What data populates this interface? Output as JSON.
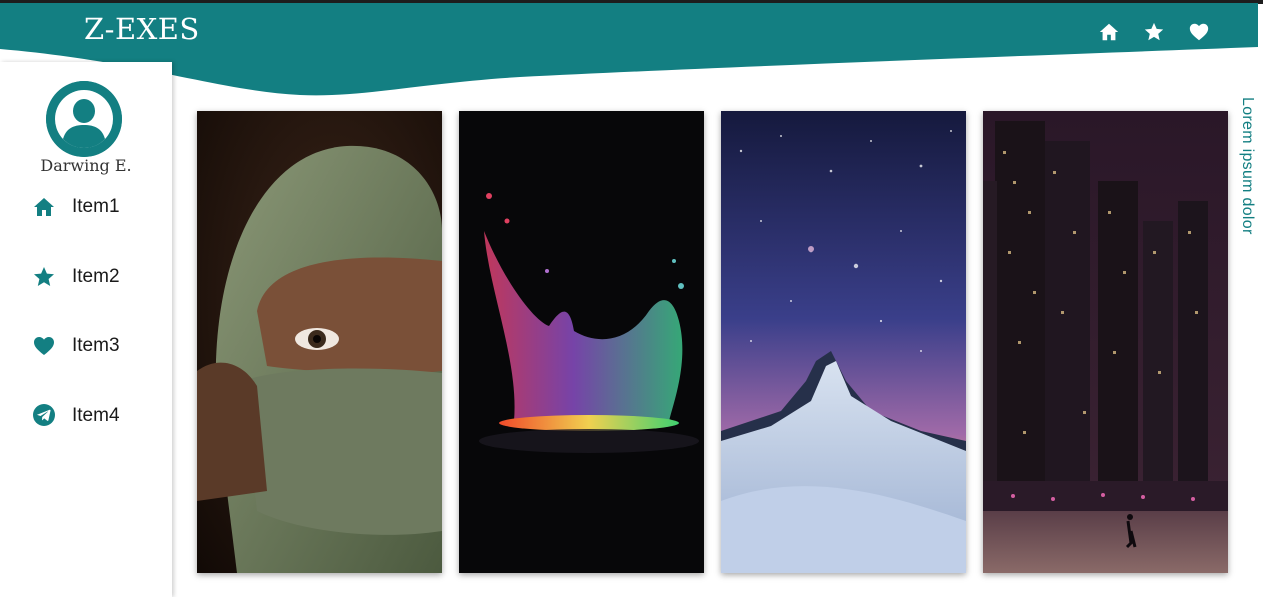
{
  "app": {
    "brand": "Z-EXES",
    "accent_color": "#137f82"
  },
  "header": {
    "actions": [
      {
        "icon": "home-icon"
      },
      {
        "icon": "star-icon"
      },
      {
        "icon": "heart-icon"
      }
    ]
  },
  "sidebar": {
    "user": {
      "name": "Darwing E.",
      "avatar_icon": "user-avatar-icon"
    },
    "items": [
      {
        "label": "Item1",
        "icon": "home-icon"
      },
      {
        "label": "Item2",
        "icon": "star-icon"
      },
      {
        "label": "Item3",
        "icon": "heart-icon"
      },
      {
        "label": "Item4",
        "icon": "telegram-icon"
      }
    ]
  },
  "gallery": {
    "cards": [
      {
        "image": "woman-with-green-scarf-image"
      },
      {
        "image": "colorful-water-splash-image"
      },
      {
        "image": "mountain-under-starry-sky-image"
      },
      {
        "image": "city-skyscrapers-at-night-image"
      }
    ]
  },
  "side_text": "Lorem ipsum dolor"
}
